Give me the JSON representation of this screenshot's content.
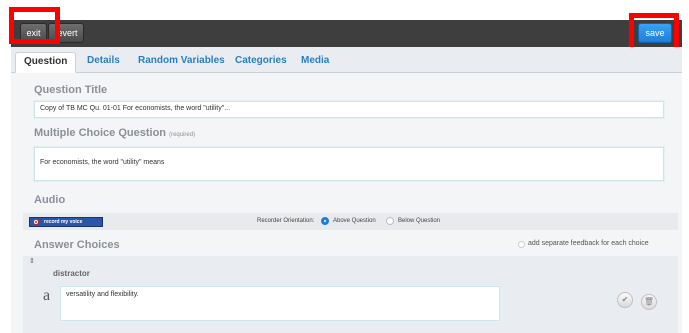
{
  "toolbar": {
    "exit_label": "exit",
    "revert_label": "revert",
    "save_label": "save"
  },
  "tabs": [
    {
      "label": "Question",
      "active": true
    },
    {
      "label": "Details",
      "active": false
    },
    {
      "label": "Random Variables",
      "active": false
    },
    {
      "label": "Categories",
      "active": false
    },
    {
      "label": "Media",
      "active": false
    }
  ],
  "question_title": {
    "heading": "Question Title",
    "value": "Copy of TB MC Qu. 01-01 For economists, the word \"utility\"..."
  },
  "mc_question": {
    "heading": "Multiple Choice Question",
    "required": "(required)",
    "value": "For economists, the word \"utility\" means"
  },
  "audio": {
    "heading": "Audio",
    "record_label": "record my voice",
    "orientation_label": "Recorder Orientation:",
    "option_above": "Above Question",
    "option_below": "Below Question",
    "selected": "Above Question"
  },
  "answer_choices": {
    "heading": "Answer Choices",
    "feedback_label": "add separate feedback for each choice",
    "drag_glyph": "⇕",
    "items": [
      {
        "type": "distractor",
        "letter": "a",
        "text": "versatility and flexibility."
      }
    ]
  },
  "icons": {
    "check": "✔",
    "trash": "🗑"
  },
  "colors": {
    "toolbar": "#3e3e3e",
    "save_button": "#1e7fd6",
    "tab_text": "#2a7ec2",
    "highlight": "#ff0000"
  }
}
